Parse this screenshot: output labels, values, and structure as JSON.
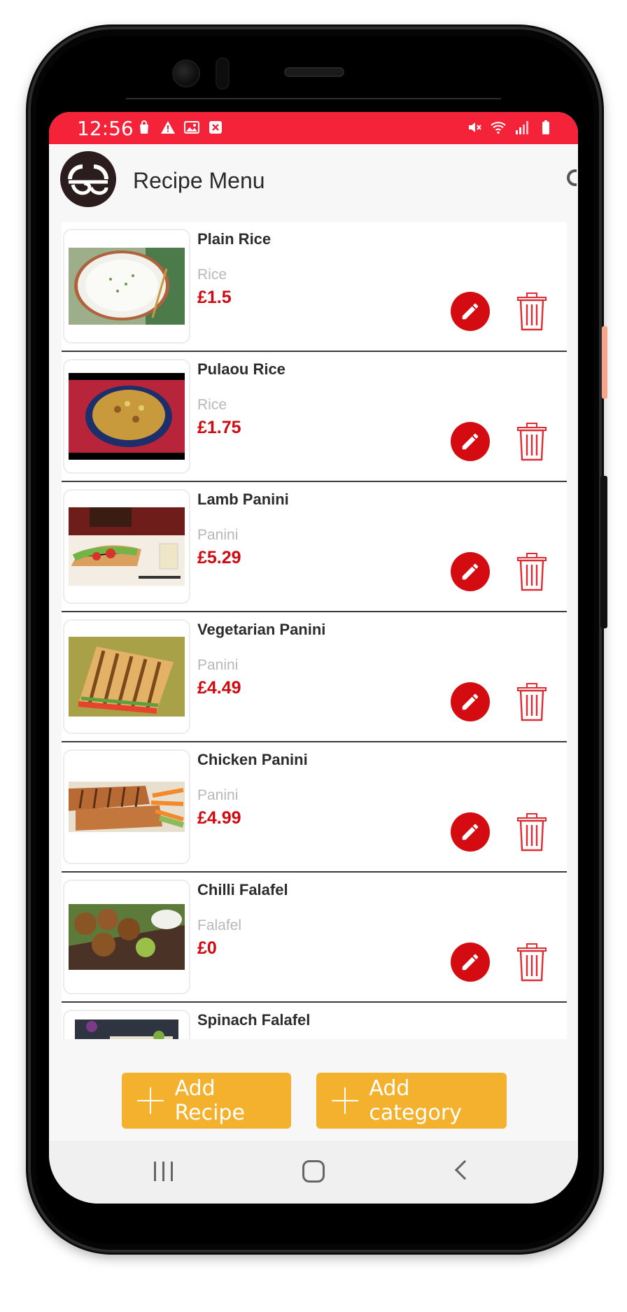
{
  "status_bar": {
    "time": "12:56",
    "left_icons": [
      "bag-icon",
      "warning-icon",
      "image-icon",
      "close-box-icon"
    ],
    "right_icons": [
      "mute-icon",
      "wifi-icon",
      "signal-icon",
      "battery-icon"
    ],
    "background": "#f4233a"
  },
  "header": {
    "title": "Recipe Menu"
  },
  "recipes": [
    {
      "name": "Plain Rice",
      "category": "Rice",
      "price": "£1.5"
    },
    {
      "name": "Pulaou Rice",
      "category": "Rice",
      "price": "£1.75"
    },
    {
      "name": "Lamb Panini",
      "category": "Panini",
      "price": "£5.29"
    },
    {
      "name": "Vegetarian Panini",
      "category": "Panini",
      "price": "£4.49"
    },
    {
      "name": "Chicken Panini",
      "category": "Panini",
      "price": "£4.99"
    },
    {
      "name": "Chilli Falafel",
      "category": "Falafel",
      "price": "£0"
    },
    {
      "name": "Spinach Falafel",
      "category": "",
      "price": ""
    }
  ],
  "actions": {
    "add_recipe": "Add Recipe",
    "add_category": "Add category"
  },
  "colors": {
    "accent_red": "#d40c12",
    "price_red": "#cf0a10",
    "button_yellow": "#f3b12e"
  }
}
